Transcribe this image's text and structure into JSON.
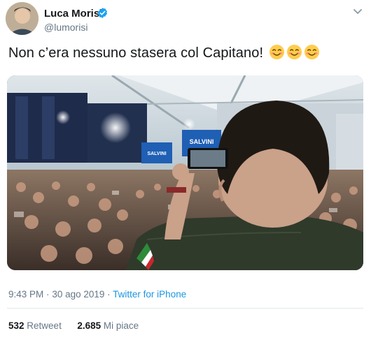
{
  "author": {
    "name": "Luca Morisi",
    "handle": "@lumorisi",
    "verified_icon": "verified-badge-icon"
  },
  "tweet": {
    "text": "Non c’era nessuno stasera col Capitano!",
    "emojis": [
      "smiling-face-icon",
      "smiling-face-icon",
      "smiling-face-icon"
    ]
  },
  "media": {
    "signs": [
      "SALVINI",
      "SALVINI"
    ]
  },
  "meta": {
    "time": "9:43 PM",
    "separator": "·",
    "date": "30 ago 2019",
    "source": "Twitter for iPhone"
  },
  "stats": {
    "retweet_count": "532",
    "retweet_label": "Retweet",
    "like_count": "2.685",
    "like_label": "Mi piace"
  },
  "colors": {
    "link": "#1b95e0",
    "secondary": "#657786",
    "verified": "#1da1f2"
  }
}
